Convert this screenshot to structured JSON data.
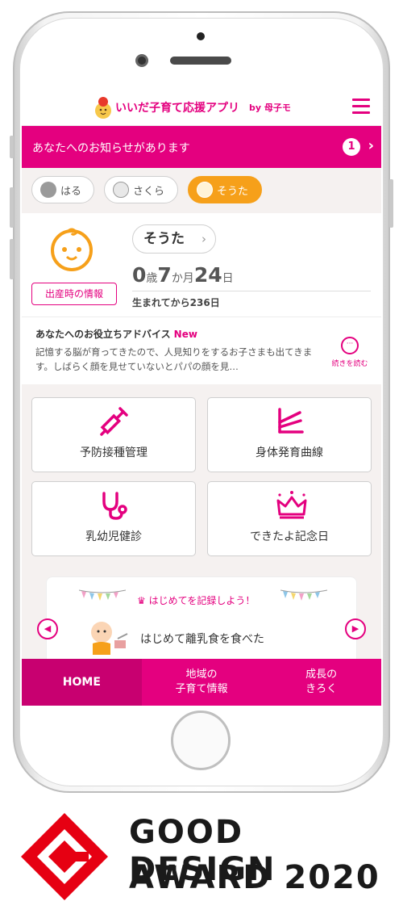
{
  "app": {
    "title": "いいだ子育て応援アプリ",
    "brand": "by 母子モ"
  },
  "notice": {
    "text": "あなたへのお知らせがあります",
    "count": "1",
    "chevron": "›"
  },
  "children": [
    {
      "name": "はる",
      "active": false
    },
    {
      "name": "さくら",
      "active": false
    },
    {
      "name": "そうた",
      "active": true
    }
  ],
  "profile": {
    "name": "そうた",
    "name_chevron": "›",
    "birth_info_label": "出産時の情報",
    "age_years": "0",
    "age_years_unit": "歳",
    "age_months": "7",
    "age_months_unit": "か月",
    "age_days": "24",
    "age_days_unit": "日",
    "days_since_birth": "生まれてから236日"
  },
  "advice": {
    "title": "あなたへのお役立ちアドバイス",
    "new_label": "New",
    "body": "記憶する脳が育ってきたので、人見知りをするお子さまも出てきます。しばらく顔を見せていないとパパの顔を見…",
    "read_more": "続きを読む"
  },
  "menu_cards": [
    {
      "label": "予防接種管理",
      "icon": "syringe-icon"
    },
    {
      "label": "身体発育曲線",
      "icon": "growth-curve-icon"
    },
    {
      "label": "乳幼児健診",
      "icon": "stethoscope-icon"
    },
    {
      "label": "できたよ記念日",
      "icon": "crown-icon"
    }
  ],
  "firsts": {
    "title": "はじめてを記録しよう！",
    "item": "はじめて離乳食を食べた",
    "prev": "◀",
    "next": "▶"
  },
  "bottom_nav": [
    {
      "label": "HOME",
      "active": true
    },
    {
      "label": "地域の\n子育て情報",
      "active": false
    },
    {
      "label": "成長の\nきろく",
      "active": false
    }
  ],
  "award": {
    "line1": "GOOD DESIGN",
    "line2": "AWARD 2020"
  },
  "colors": {
    "accent": "#e4007f",
    "active_child": "#f6a01a",
    "award_red": "#e60012"
  }
}
